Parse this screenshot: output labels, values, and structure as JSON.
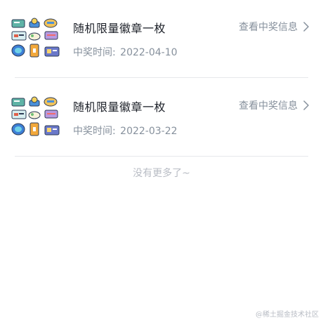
{
  "records": [
    {
      "title": "随机限量徽章一枚",
      "date_label": "中奖时间:",
      "date": "2022-04-10",
      "view_label": "查看中奖信息"
    },
    {
      "title": "随机限量徽章一枚",
      "date_label": "中奖时间:",
      "date": "2022-03-22",
      "view_label": "查看中奖信息"
    }
  ],
  "footer": {
    "no_more": "没有更多了~"
  },
  "watermark": "@稀土掘金技术社区",
  "colors": {
    "title": "#1d2129",
    "secondary": "#86909c",
    "divider": "#e6e7eb",
    "muted": "#b8bcc4"
  },
  "icons": [
    "badge-collage-icon",
    "chevron-right-icon"
  ]
}
